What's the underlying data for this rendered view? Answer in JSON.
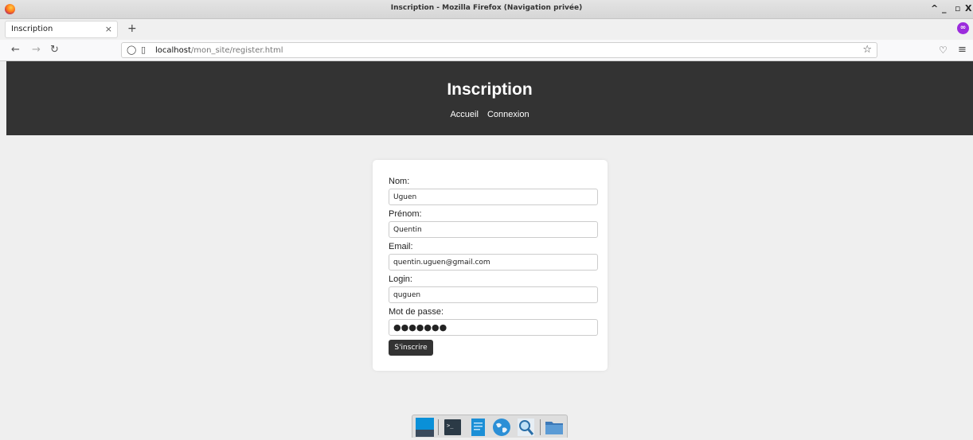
{
  "window": {
    "title": "Inscription - Mozilla Firefox (Navigation privée)",
    "controls": [
      "^",
      "_",
      "▫",
      "X"
    ]
  },
  "browser": {
    "tab_label": "Inscription",
    "tab_close": "×",
    "new_tab": "+",
    "url_host": "localhost",
    "url_path": "/mon_site/register.html"
  },
  "page": {
    "title": "Inscription",
    "nav": [
      "Accueil",
      "Connexion"
    ]
  },
  "form": {
    "fields": [
      {
        "label": "Nom:",
        "value": "Uguen"
      },
      {
        "label": "Prénom:",
        "value": "Quentin"
      },
      {
        "label": "Email:",
        "value": "quentin.uguen@gmail.com"
      },
      {
        "label": "Login:",
        "value": "quguen"
      },
      {
        "label": "Mot de passe:",
        "value": "●●●●●●●"
      }
    ],
    "submit_label": "S'inscrire"
  },
  "dock": {
    "icons": [
      "desktop-icon",
      "terminal-icon",
      "text-editor-icon",
      "web-browser-icon",
      "search-icon",
      "file-manager-icon"
    ]
  },
  "colors": {
    "header_bg": "#333333",
    "page_bg": "#efefef",
    "button_bg": "#333333",
    "private_accent": "#9b2bdc"
  }
}
